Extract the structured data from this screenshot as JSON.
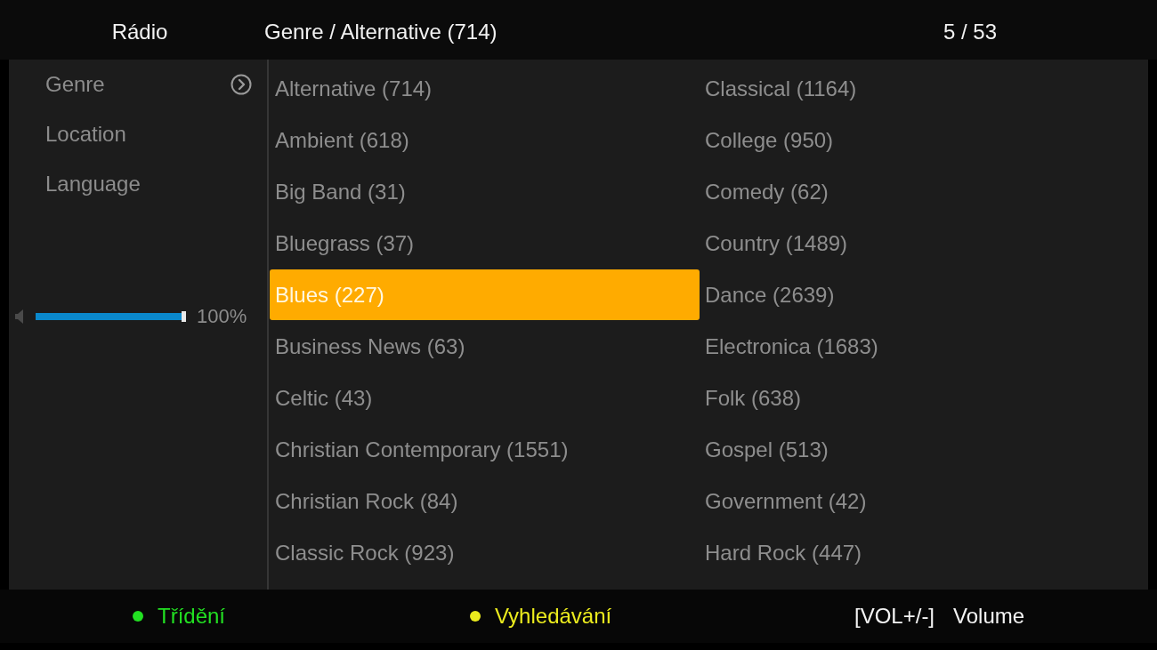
{
  "header": {
    "title": "Rádio",
    "path": "Genre / Alternative (714)",
    "page": "5 / 53"
  },
  "sidebar": {
    "items": [
      {
        "label": "Genre",
        "selected": true
      },
      {
        "label": "Location",
        "selected": false
      },
      {
        "label": "Language",
        "selected": false
      }
    ],
    "volume": {
      "level": 1,
      "reading": "100%"
    }
  },
  "genres": [
    {
      "label": "Alternative (714)",
      "selected": false
    },
    {
      "label": "Ambient (618)",
      "selected": false
    },
    {
      "label": "Big Band (31)",
      "selected": false
    },
    {
      "label": "Bluegrass (37)",
      "selected": false
    },
    {
      "label": "Blues (227)",
      "selected": true
    },
    {
      "label": "Business News (63)",
      "selected": false
    },
    {
      "label": "Celtic (43)",
      "selected": false
    },
    {
      "label": "Christian Contemporary (1551)",
      "selected": false
    },
    {
      "label": "Christian Rock (84)",
      "selected": false
    },
    {
      "label": "Classic Rock (923)",
      "selected": false
    },
    {
      "label": "Classical (1164)",
      "selected": false
    },
    {
      "label": "College (950)",
      "selected": false
    },
    {
      "label": "Comedy (62)",
      "selected": false
    },
    {
      "label": "Country (1489)",
      "selected": false
    },
    {
      "label": "Dance (2639)",
      "selected": false
    },
    {
      "label": "Electronica (1683)",
      "selected": false
    },
    {
      "label": "Folk (638)",
      "selected": false
    },
    {
      "label": "Gospel (513)",
      "selected": false
    },
    {
      "label": "Government (42)",
      "selected": false
    },
    {
      "label": "Hard Rock (447)",
      "selected": false
    }
  ],
  "footer": {
    "hints": [
      {
        "kind": "color-key",
        "color": "#22e022",
        "label": "Třídění"
      },
      {
        "kind": "color-key",
        "color": "#ecec1e",
        "label": "Vyhledávání"
      },
      {
        "kind": "key",
        "key": "[VOL+/-]",
        "label": "Volume"
      }
    ]
  }
}
